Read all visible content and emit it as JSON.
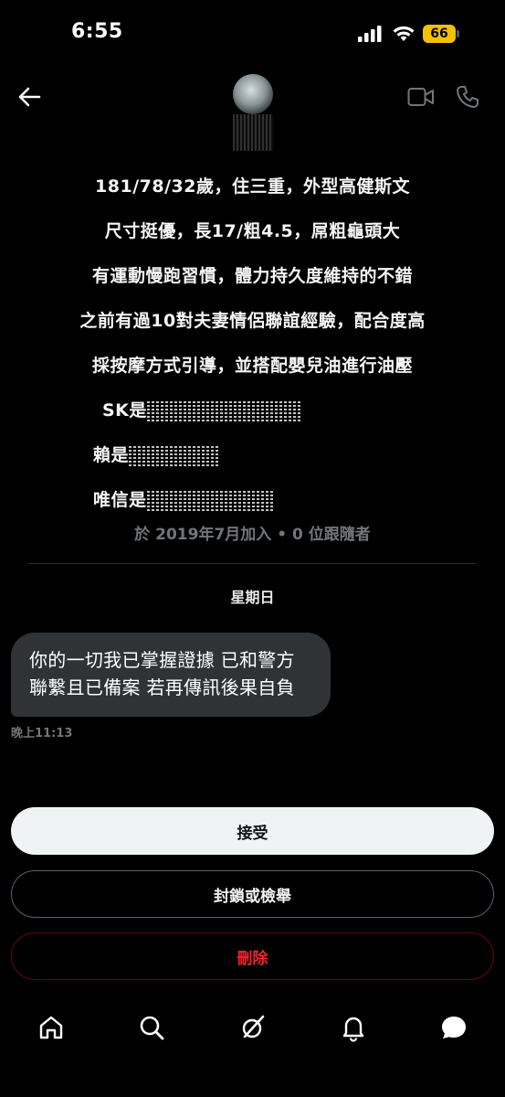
{
  "status_bar": {
    "time": "6:55",
    "battery": "66",
    "battery_color": "#f2c200"
  },
  "header": {
    "back_icon": "arrow-left-icon",
    "video_icon": "video-camera-icon",
    "call_icon": "phone-icon"
  },
  "profile": {
    "bio_lines": [
      "181/78/32歲，住三重，外型高健斯文",
      "尺寸挺優，長17/粗4.5，屌粗龜頭大",
      "有運動慢跑習慣，體力持久度維持的不錯",
      "之前有過10對夫妻情侶聯誼經驗，配合度高",
      "採按摩方式引導，並搭配嬰兒油進行油壓"
    ],
    "contact_lines": [
      {
        "prefix": "SK是"
      },
      {
        "prefix": "賴是"
      },
      {
        "prefix": "唯信是"
      }
    ],
    "joined": "於 2019年7月加入 • 0 位跟隨者"
  },
  "conversation": {
    "day_label": "星期日",
    "message": {
      "lines": [
        "你的一切我已掌握證據 已和警方",
        "聯繫且已備案 若再傳訊後果自負"
      ],
      "time": "晚上11:13"
    }
  },
  "actions": {
    "accept": "接受",
    "block_report": "封鎖或檢舉",
    "delete": "刪除",
    "delete_color": "#f4212e"
  },
  "tabbar": {
    "items": [
      "home-icon",
      "search-icon",
      "grok-icon",
      "bell-icon",
      "messages-icon"
    ]
  }
}
